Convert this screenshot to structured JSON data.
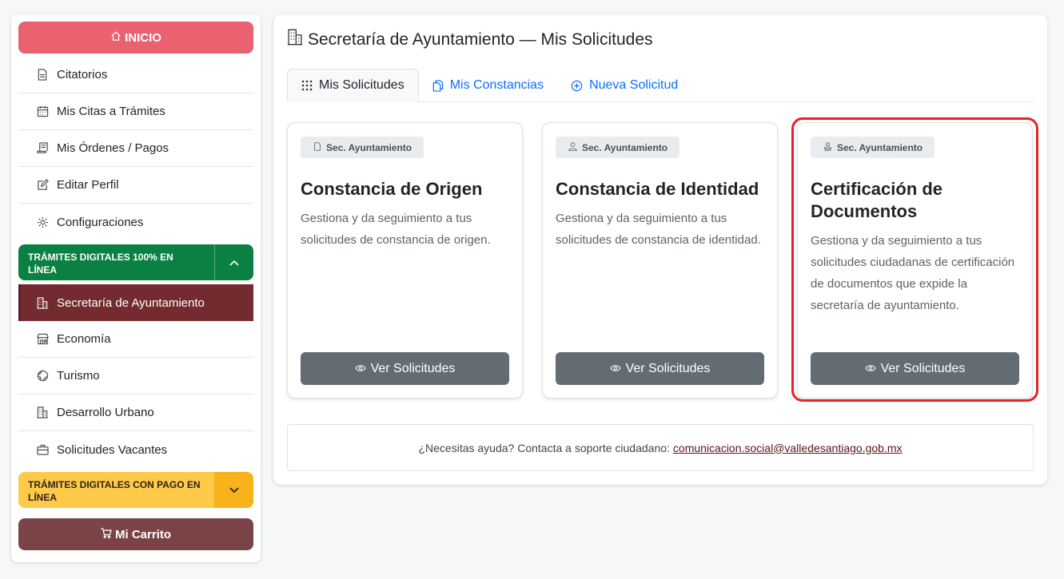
{
  "sidebar": {
    "inicio_label": "INICIO",
    "items": [
      {
        "label": "Citatorios",
        "icon": "document-icon"
      },
      {
        "label": "Mis Citas a Trámites",
        "icon": "calendar-icon"
      },
      {
        "label": "Mis Órdenes / Pagos",
        "icon": "receipt-icon"
      },
      {
        "label": "Editar Perfil",
        "icon": "edit-icon"
      },
      {
        "label": "Configuraciones",
        "icon": "gear-icon"
      }
    ],
    "group_digital": {
      "label": "TRÁMITES DIGITALES 100% EN LÍNEA",
      "items": [
        {
          "label": "Secretaría de Ayuntamiento",
          "icon": "building-icon",
          "active": true
        },
        {
          "label": "Economía",
          "icon": "shop-icon"
        },
        {
          "label": "Turismo",
          "icon": "globe-icon"
        },
        {
          "label": "Desarrollo Urbano",
          "icon": "building-icon"
        },
        {
          "label": "Solicitudes Vacantes",
          "icon": "briefcase-icon"
        }
      ]
    },
    "group_payment": {
      "label": "TRÁMITES DIGITALES CON PAGO EN LÍNEA"
    },
    "cart_label": "Mi Carrito"
  },
  "main": {
    "title": "Secretaría de Ayuntamiento — Mis Solicitudes",
    "tabs": [
      {
        "label": "Mis Solicitudes",
        "icon": "grid-icon",
        "active": true
      },
      {
        "label": "Mis Constancias",
        "icon": "copy-icon"
      },
      {
        "label": "Nueva Solicitud",
        "icon": "plus-circle-icon"
      }
    ],
    "cards": [
      {
        "badge": "Sec. Ayuntamiento",
        "badge_icon": "document-icon",
        "title": "Constancia de Origen",
        "description": "Gestiona y da seguimiento a tus solicitudes de constancia de origen.",
        "button": "Ver Solicitudes"
      },
      {
        "badge": "Sec. Ayuntamiento",
        "badge_icon": "person-icon",
        "title": "Constancia de Identidad",
        "description": "Gestiona y da seguimiento a tus solicitudes de constancia de identidad.",
        "button": "Ver Solicitudes"
      },
      {
        "badge": "Sec. Ayuntamiento",
        "badge_icon": "stamp-icon",
        "title": "Certificación de Documentos",
        "description": "Gestiona y da seguimiento a tus solicitudes ciudadanas de certificación de documentos que expide la secretaría de ayuntamiento.",
        "button": "Ver Solicitudes"
      }
    ],
    "help": {
      "text": "¿Necesitas ayuda? Contacta a soporte ciudadano:",
      "email": "comunicacion.social@valledesantiago.gob.mx"
    }
  },
  "colors": {
    "inicio": "#ea6170",
    "active_item": "#732b2f",
    "group_green": "#0b8043",
    "group_yellow": "#ffc94a",
    "cart": "#7a4447",
    "card_button": "#646c73",
    "highlight": "#e52323"
  }
}
